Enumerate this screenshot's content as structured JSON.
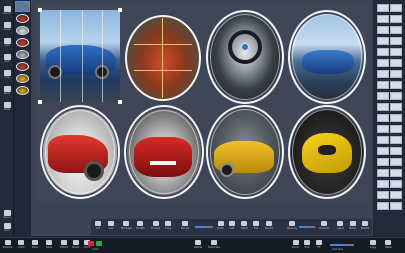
{
  "left_toolbar": {
    "items": [
      {
        "label": "Import",
        "icon": "folder-icon"
      },
      {
        "label": "Cover",
        "icon": "image-icon"
      },
      {
        "label": "Add",
        "icon": "plus-icon"
      },
      {
        "label": "Text",
        "icon": "text-icon"
      },
      {
        "label": "Clip",
        "icon": "clip-icon"
      },
      {
        "label": "Back",
        "icon": "background-icon"
      },
      {
        "label": "Mask",
        "icon": "mask-icon"
      },
      {
        "label": "Zoom",
        "icon": "zoom-icon"
      },
      {
        "label": "Grid",
        "icon": "grid-icon"
      }
    ]
  },
  "float_toolbar": {
    "items": [
      "Cut",
      "Cell",
      "Montage",
      "Shuffle",
      "Frames",
      "Copy",
      "Order",
      "Left",
      "Right",
      "Flip",
      "Layer",
      "Mirror",
      "Rotate"
    ],
    "border_label": "Border",
    "round_label": "Round",
    "spacing_label": "Spacing",
    "shadow_label": "Shadow"
  },
  "bottom_bar": {
    "left_items": [
      "Explore",
      "Undo",
      "Redo",
      "Save",
      "Export",
      "Share",
      "Print"
    ],
    "color_label": "Color",
    "right_items": [
      "Delete",
      "Duplicate",
      "Zoom",
      "Edit",
      "Fit"
    ],
    "size_label": "Grid size",
    "right_end": [
      "Copy",
      "Paste"
    ]
  },
  "colors": {
    "accent": "#3b8de0",
    "canvas": "#3e4658",
    "ring": "#f4f6fa",
    "swatch_red": "#d62c2c",
    "swatch_green": "#2aa84a",
    "swatch_blue": "#2d66c9"
  }
}
